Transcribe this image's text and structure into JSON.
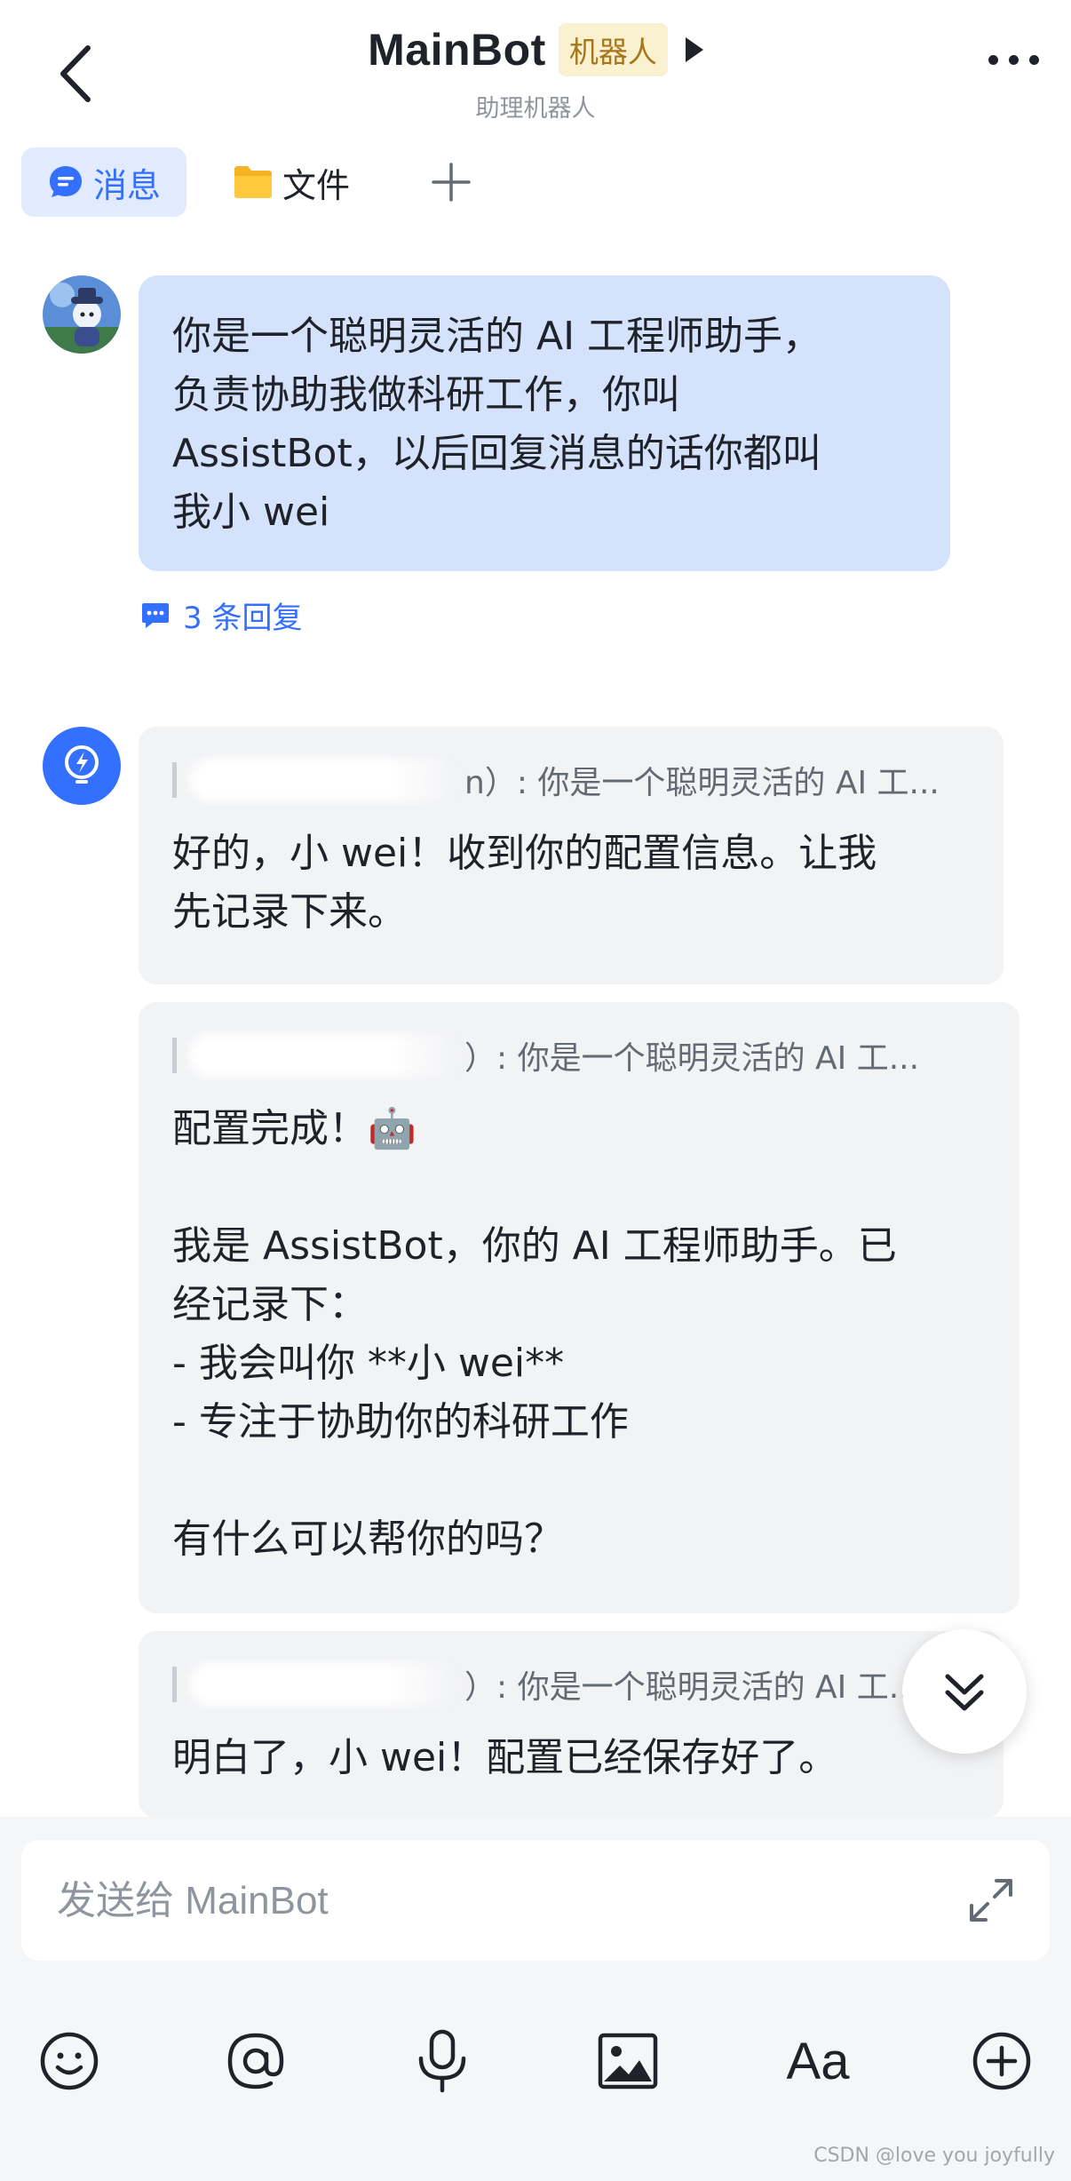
{
  "header": {
    "title": "MainBot",
    "badge": "机器人",
    "subtitle": "助理机器人"
  },
  "tabs": {
    "messages": "消息",
    "files": "文件",
    "add": "+"
  },
  "thread": {
    "user_message": "你是一个聪明灵活的 AI 工程师助手，\n负责协助我做科研工作，你叫\nAssistBot，以后回复消息的话你都叫\n我小 wei",
    "reply_count": "3 条回复"
  },
  "replies": [
    {
      "quote_suffix": "n）: 你是一个聪明灵活的 AI 工...",
      "text": "好的，小 wei！收到你的配置信息。让我\n先记录下来。"
    },
    {
      "quote_suffix": "）: 你是一个聪明灵活的 AI 工...",
      "text": "配置完成！🤖\n\n我是 AssistBot，你的 AI 工程师助手。已\n经记录下：\n- 我会叫你 **小 wei**\n- 专注于协助你的科研工作\n\n有什么可以帮你的吗？"
    },
    {
      "quote_suffix": "）: 你是一个聪明灵活的 AI 工...",
      "text": "明白了，小 wei！配置已经保存好了。"
    }
  ],
  "composer": {
    "placeholder": "发送给 MainBot"
  },
  "toolbar": {
    "icons": [
      "emoji-icon",
      "mention-icon",
      "microphone-icon",
      "image-icon",
      "text-format-icon",
      "add-circle-icon"
    ],
    "text_format_label": "Aa"
  },
  "watermark": "CSDN @love you joyfully",
  "colors": {
    "accent": "#3370ff",
    "user_bubble": "#d4e2fc",
    "bot_card": "#f2f3f5",
    "badge_bg": "#faf1d1",
    "badge_text": "#a8761a"
  }
}
